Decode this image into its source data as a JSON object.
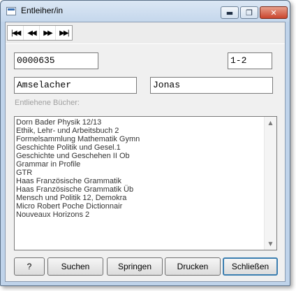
{
  "window": {
    "title": "Entleiher/in",
    "minimize": "▬",
    "maximize": "❐",
    "close": "✕"
  },
  "nav": {
    "first": "|◀◀",
    "prev": "◀◀",
    "next": "▶▶",
    "last": "▶▶|"
  },
  "fields": {
    "number": "0000635",
    "class": "1-2",
    "lastname": "Amselacher",
    "firstname": "Jonas"
  },
  "books_label": "Entliehene Bücher:",
  "books": [
    "Dorn Bader Physik 12/13",
    "Ethik, Lehr- und Arbeitsbuch 2",
    "Formelsammlung Mathematik Gymn",
    "Geschichte Politik und Gesel.1",
    "Geschichte und Geschehen II Ob",
    "Grammar in Profile",
    "GTR",
    "Haas Französische Grammatik",
    "Haas Französische Grammatik Üb",
    "Mensch und Politik 12, Demokra",
    "Micro Robert Poche Dictionnair",
    "Nouveaux Horizons 2"
  ],
  "scroll": {
    "up": "▲",
    "down": "▼"
  },
  "buttons": {
    "help": "?",
    "search": "Suchen",
    "jump": "Springen",
    "print": "Drucken",
    "close": "Schließen"
  }
}
